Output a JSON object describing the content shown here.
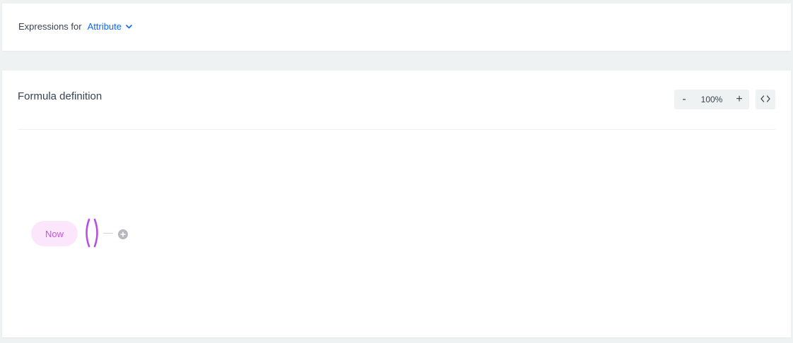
{
  "header": {
    "expressions_label": "Expressions for",
    "type_selected": "Attribute",
    "dropdown_icon": "chevron-down-icon"
  },
  "formula": {
    "title": "Formula definition",
    "zoom": {
      "minus_label": "-",
      "value": "100%",
      "plus_label": "+",
      "code_icon": "code-icon"
    },
    "node": {
      "label": "Now",
      "add_icon": "plus-circle-icon"
    }
  },
  "colors": {
    "accent_blue": "#0b68ff",
    "node_bg": "#fbe6fc",
    "node_text": "#c356d8",
    "paren_color": "#b84fe0"
  }
}
